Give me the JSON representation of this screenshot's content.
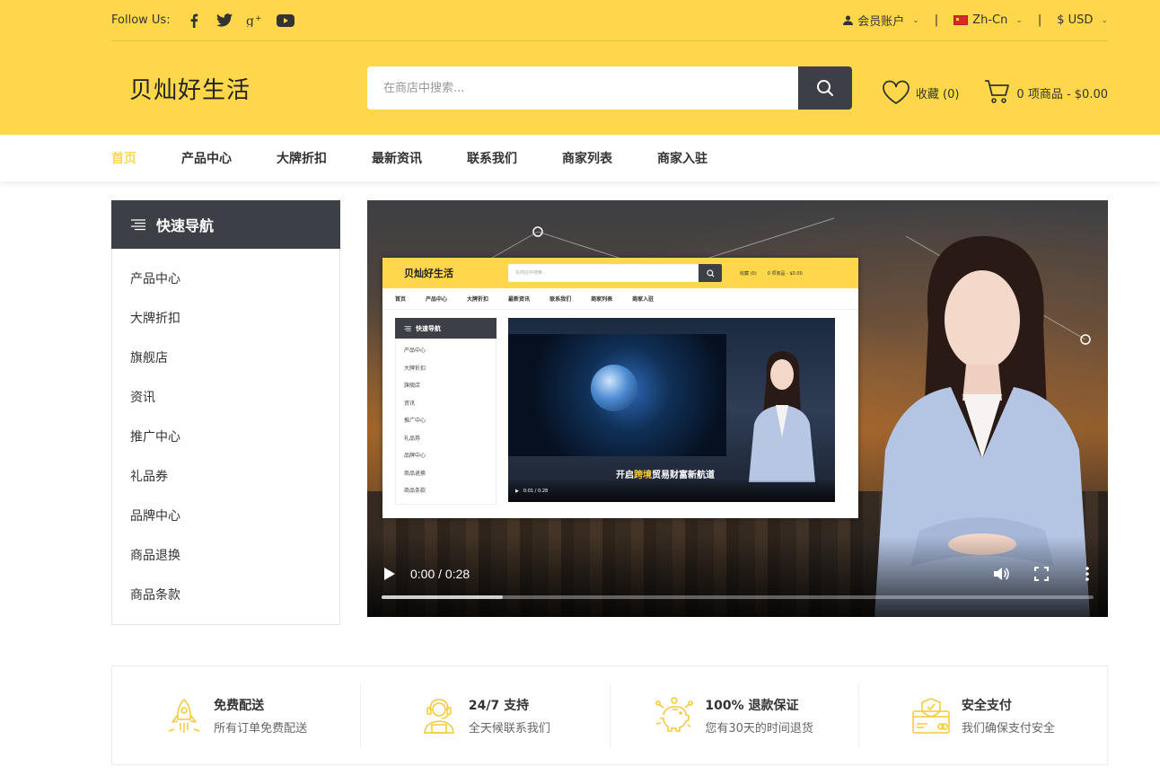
{
  "topbar": {
    "follow_label": "Follow Us:",
    "social": [
      "facebook-icon",
      "twitter-icon",
      "google-plus-icon",
      "youtube-icon"
    ],
    "account": "会员账户",
    "language": "Zh-Cn",
    "currency": "$ USD",
    "separator": "|"
  },
  "header": {
    "logo": "贝灿好生活",
    "search_placeholder": "在商店中搜索...",
    "wishlist": "收藏 (0)",
    "cart": "0 项商品 - $0.00"
  },
  "nav": [
    "首页",
    "产品中心",
    "大牌折扣",
    "最新资讯",
    "联系我们",
    "商家列表",
    "商家入驻"
  ],
  "sidebar": {
    "title": "快速导航",
    "items": [
      "产品中心",
      "大牌折扣",
      "旗舰店",
      "资讯",
      "推广中心",
      "礼品券",
      "品牌中心",
      "商品退换",
      "商品条款"
    ]
  },
  "video": {
    "time": "0:00 / 0:28",
    "progress": 0.17,
    "mini": {
      "logo": "贝灿好生活",
      "search_placeholder": "在商店中搜索...",
      "wishlist": "收藏 (0)",
      "cart": "0 项商品 - $0.00",
      "caption_pre": "开启",
      "caption_hl": "跨境",
      "caption_post": "贸易财富新航道",
      "time": "0:01 / 0:28"
    }
  },
  "features": [
    {
      "icon": "rocket-icon",
      "title": "免费配送",
      "desc": "所有订单免费配送"
    },
    {
      "icon": "support-agent-icon",
      "title": "24/7 支持",
      "desc": "全天候联系我们"
    },
    {
      "icon": "piggy-bank-icon",
      "title": "100% 退款保证",
      "desc": "您有30天的时间退货"
    },
    {
      "icon": "secure-card-icon",
      "title": "安全支付",
      "desc": "我们确保支付安全"
    }
  ],
  "colors": {
    "accent": "#fed84a",
    "dark": "#3c3f45"
  }
}
